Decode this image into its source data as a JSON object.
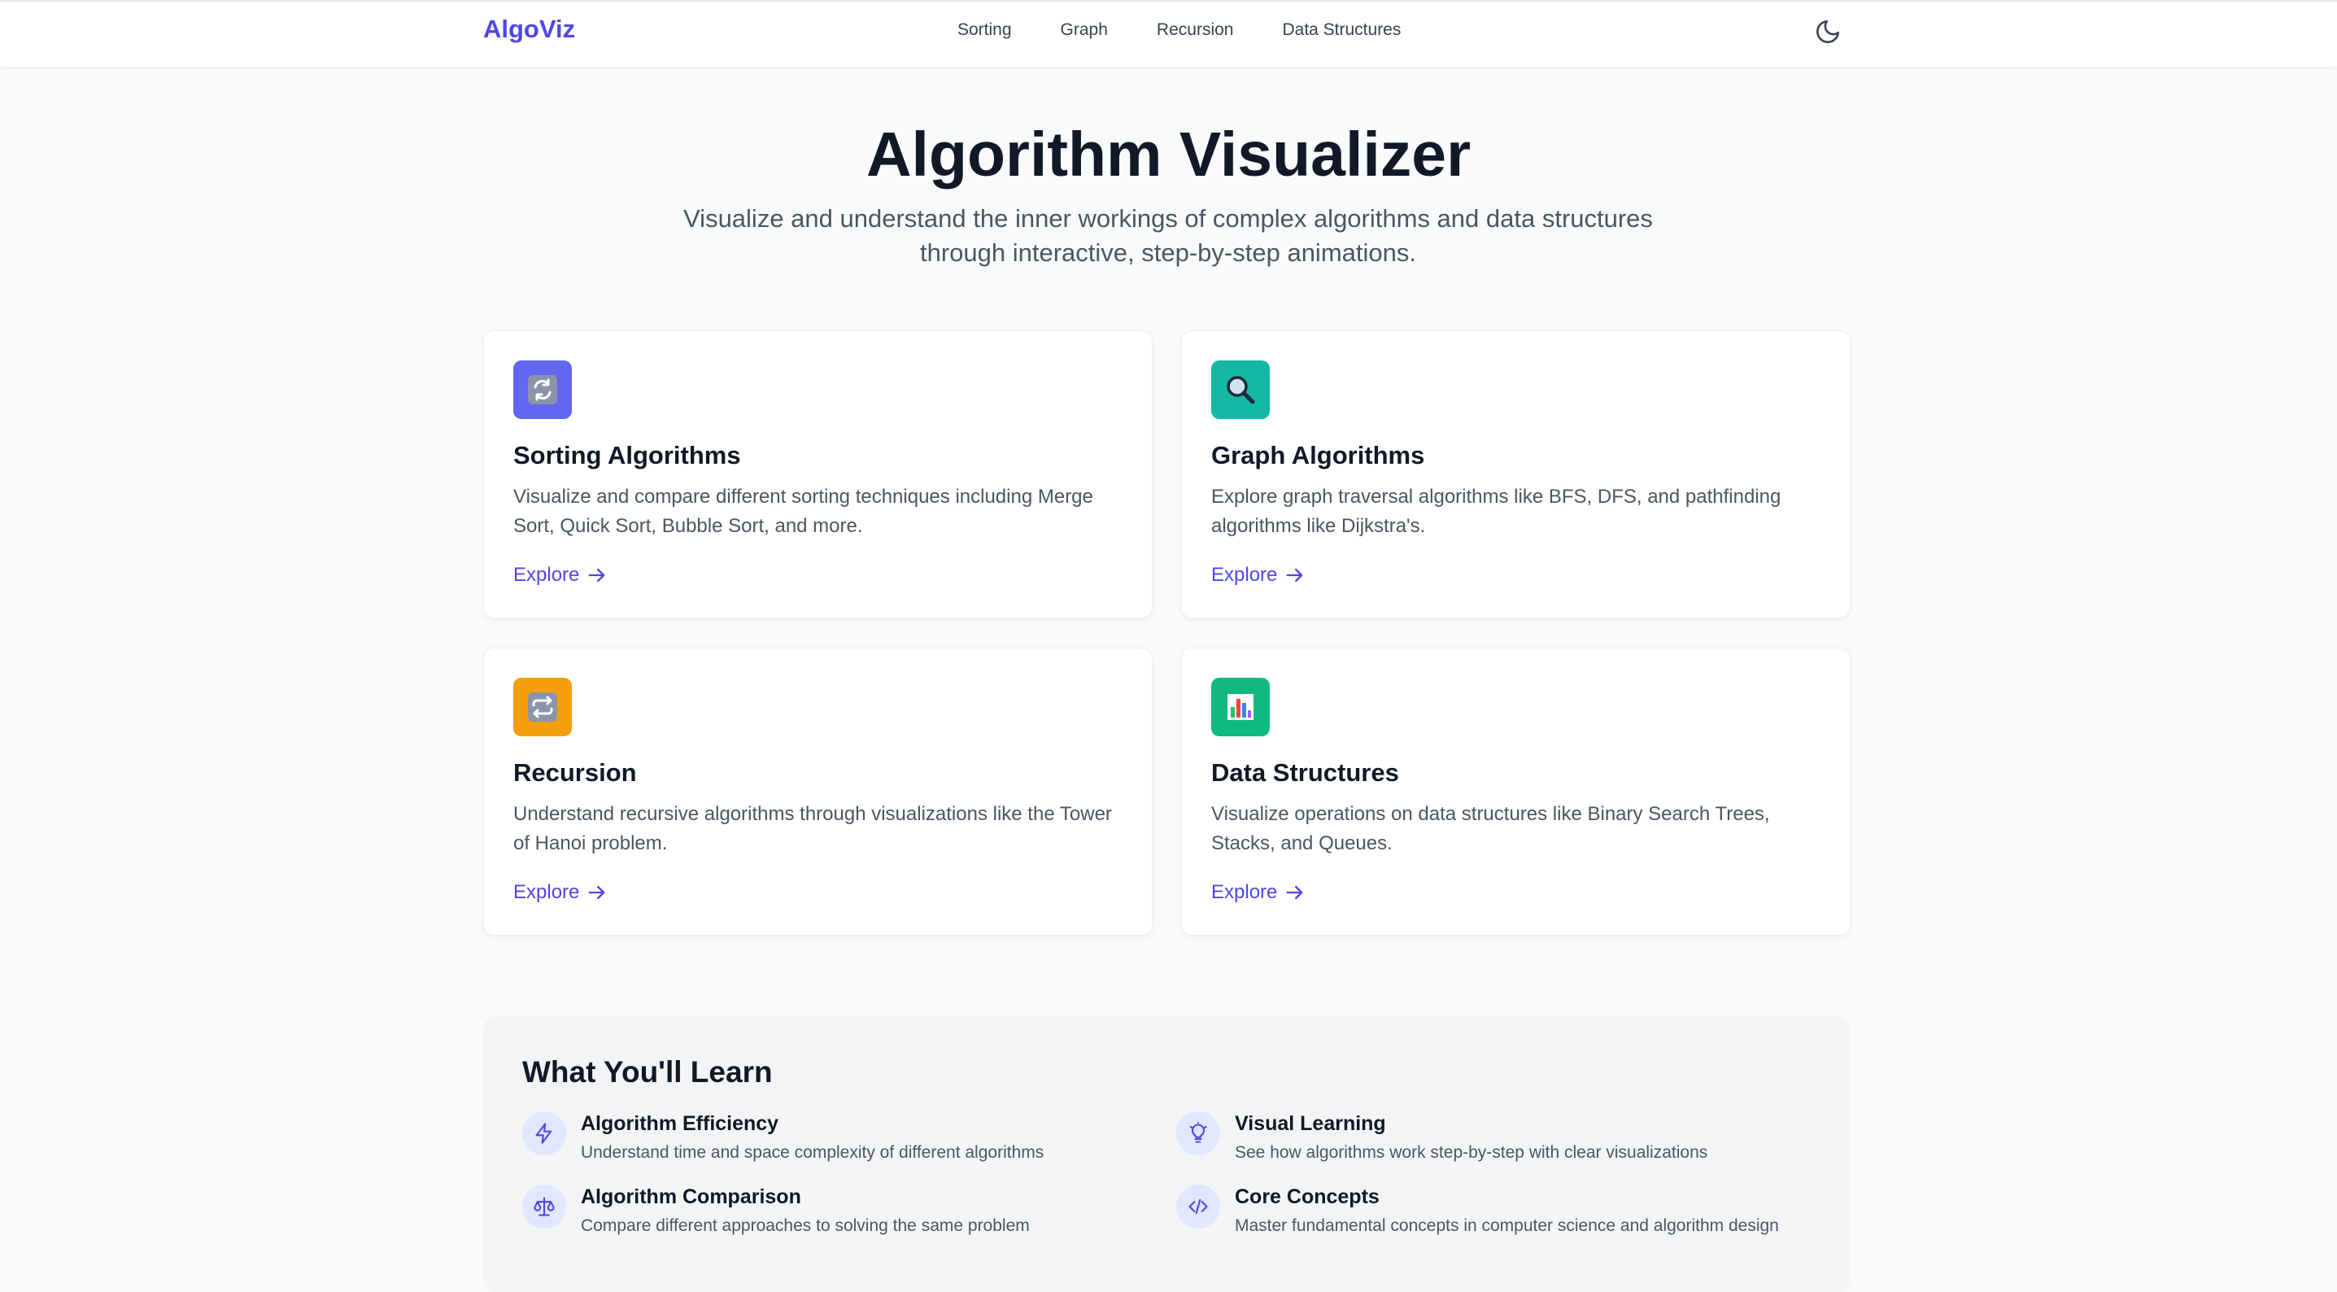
{
  "nav": {
    "logo": "AlgoViz",
    "links": [
      "Sorting",
      "Graph",
      "Recursion",
      "Data Structures"
    ]
  },
  "hero": {
    "title": "Algorithm Visualizer",
    "subtitle": "Visualize and understand the inner workings of complex algorithms and data structures through interactive, step-by-step animations."
  },
  "cards": [
    {
      "title": "Sorting Algorithms",
      "description": "Visualize and compare different sorting techniques including Merge Sort, Quick Sort, Bubble Sort, and more.",
      "link": "Explore",
      "icon": "refresh-icon",
      "color": "#6366f1"
    },
    {
      "title": "Graph Algorithms",
      "description": "Explore graph traversal algorithms like BFS, DFS, and pathfinding algorithms like Dijkstra's.",
      "link": "Explore",
      "icon": "magnifier-icon",
      "color": "#14b8a6"
    },
    {
      "title": "Recursion",
      "description": "Understand recursive algorithms through visualizations like the Tower of Hanoi problem.",
      "link": "Explore",
      "icon": "repeat-icon",
      "color": "#f59e0b"
    },
    {
      "title": "Data Structures",
      "description": "Visualize operations on data structures like Binary Search Trees, Stacks, and Queues.",
      "link": "Explore",
      "icon": "bar-chart-icon",
      "color": "#10b981"
    }
  ],
  "learn": {
    "title": "What You'll Learn",
    "items": [
      {
        "name": "Algorithm Efficiency",
        "description": "Understand time and space complexity of different algorithms",
        "icon": "lightning-icon"
      },
      {
        "name": "Visual Learning",
        "description": "See how algorithms work step-by-step with clear visualizations",
        "icon": "lightbulb-icon"
      },
      {
        "name": "Algorithm Comparison",
        "description": "Compare different approaches to solving the same problem",
        "icon": "scale-icon"
      },
      {
        "name": "Core Concepts",
        "description": "Master fundamental concepts in computer science and algorithm design",
        "icon": "code-icon"
      }
    ]
  }
}
